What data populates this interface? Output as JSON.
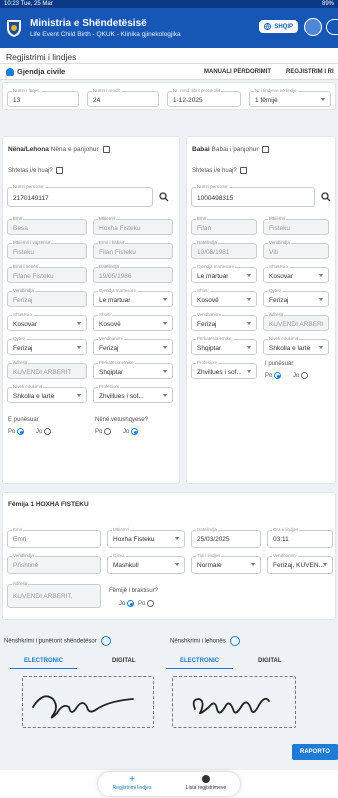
{
  "status_bar": {
    "time": "10:23 Tue, 25 Mar",
    "battery": "89%"
  },
  "app": {
    "title": "Ministria e Shëndetësisë",
    "subtitle": "Life Event Child Birth - QKUK - Klinika gjinekologjika",
    "language_button": "SHQIP"
  },
  "page": {
    "heading": "Regjistrimi i lindjes",
    "section": "Gjendja civile",
    "tabs": [
      "MANUALI PËRDORIMIT",
      "REGJISTRIM I RI"
    ]
  },
  "top_fields": [
    {
      "label": "Numri i faqes",
      "value": "13"
    },
    {
      "label": "Numri i rendit",
      "value": "24"
    },
    {
      "label": "Nr. rend. librit protokollit",
      "value": "1-12-2025"
    },
    {
      "label": "Nr i lindjeve në lindje",
      "value": "1 fëmijë"
    }
  ],
  "mother": {
    "title": "Nëna/Lehona",
    "sub": "Nëna e panjohur",
    "foreigner": "Shtetas i/e huaj?",
    "personal_number_label": "Numri personal",
    "personal_number": "2170149117",
    "fields": [
      {
        "label": "Emri",
        "value": "Besa"
      },
      {
        "label": "Mbiemri",
        "value": "Hoxha Fisteku"
      },
      {
        "label": "Mbiemri i vajzërisë",
        "value": "Fisteku"
      },
      {
        "label": "Emri i babait",
        "value": "Filan Fisteku"
      },
      {
        "label": "Emri i nënës",
        "value": "Filane Fisteku"
      },
      {
        "label": "Datëlindja",
        "value": "19/05/1986"
      },
      {
        "label": "Vendlindja",
        "value": "Ferizaj"
      },
      {
        "label": "Gjendja martesore",
        "value": "Le martuar"
      },
      {
        "label": "Shtetësia",
        "value": "Kosovar"
      },
      {
        "label": "Shteti",
        "value": "Kosovë"
      },
      {
        "label": "Qyteti",
        "value": "Ferizaj"
      },
      {
        "label": "Vendbanimi",
        "value": "Ferizaj"
      },
      {
        "label": "Adresa",
        "value": "KUVENDI ARBËRIT"
      },
      {
        "label": "Përkatësia etnike",
        "value": "Shqiptar"
      },
      {
        "label": "Niveli edukimit",
        "value": "Shkolla e lartë"
      },
      {
        "label": "Profesioni",
        "value": "Zhvillues i sof..."
      }
    ],
    "employed_label": "E punësuar",
    "self_employed_label": "Nënë vetushqyese?",
    "yes": "Po",
    "no": "Jo"
  },
  "father": {
    "title": "Babai",
    "sub": "Babai i panjohur",
    "foreigner": "Shtetas i/e huaj?",
    "personal_number_label": "Numri personal",
    "personal_number": "1000498315",
    "fields": [
      {
        "label": "Emri",
        "value": "Filan"
      },
      {
        "label": "Mbiemri",
        "value": "Fisteku"
      },
      {
        "label": "Datëlindja",
        "value": "10/08/1981"
      },
      {
        "label": "Vendlindja",
        "value": "Viti"
      },
      {
        "label": "Gjendja martesore",
        "value": "Le martuar"
      },
      {
        "label": "Shtetësia",
        "value": "Kosovar"
      },
      {
        "label": "Shteti",
        "value": "Kosovë"
      },
      {
        "label": "Qyteti",
        "value": "Ferizaj"
      },
      {
        "label": "Vendbanimi",
        "value": "Ferizaj"
      },
      {
        "label": "Adresa",
        "value": "KUVENDI ARBËRIT"
      },
      {
        "label": "Përkatësia etnike",
        "value": "Shqiptar"
      },
      {
        "label": "Niveli edukimit",
        "value": "Shkolla e lartë"
      },
      {
        "label": "Profesioni",
        "value": "Zhvillues i sof..."
      }
    ],
    "employed_label": "I punësuar",
    "yes": "Po",
    "no": "Jo"
  },
  "child": {
    "title": "Fëmija 1 HOXHA FISTEKU",
    "fields": [
      {
        "label": "Emri",
        "value": "Emri"
      },
      {
        "label": "Mbiemri",
        "value": "Hoxha Fisteku"
      },
      {
        "label": "Datëlindja",
        "value": "25/03/2025"
      },
      {
        "label": "Ora e lindjes",
        "value": "03:11"
      },
      {
        "label": "Vendlindja",
        "value": "Prishtinë"
      },
      {
        "label": "Gjinia",
        "value": "Mashkull"
      },
      {
        "label": "Tipi i lindjes",
        "value": "Normale"
      },
      {
        "label": "Vendbanimi",
        "value": "Ferizaj, KUVEN..."
      },
      {
        "label": "Adresa",
        "value": "KUVENDI ARBËRIT,"
      }
    ],
    "twin_label": "Fëmijë i braktisur?",
    "yes": "Po",
    "no": "Jo"
  },
  "signatures": {
    "doctor_label": "Nënshkrimi i punëtorit shëndetësor",
    "mother_label": "Nënshkrimi i lehonës",
    "tab_electronic": "ELECTRONIC",
    "tab_digital": "DIGITAL"
  },
  "actions": {
    "report": "RAPORTO"
  },
  "bottom_nav": {
    "item1": "Regjistrimi lindjes",
    "item2": "Lista regjistrimeve"
  },
  "colors": {
    "primary": "#1657b5",
    "accent": "#1e7bd7"
  }
}
